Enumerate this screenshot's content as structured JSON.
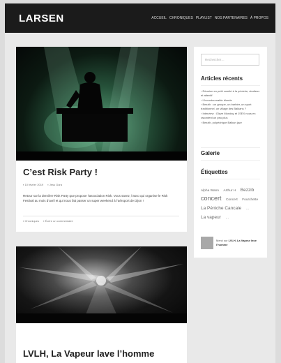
{
  "header": {
    "logo": "LARSEN",
    "nav": [
      "ACCUEIL",
      "CHRONIQUES",
      "PLAYLIST",
      "NOS PARTENAIRES",
      "À PROPOS"
    ]
  },
  "posts": [
    {
      "title": "C’est Risk Party !",
      "date": "10 février 2019",
      "author": "Jess Gora",
      "excerpt": "Retour sur la dernière Risk Party que propose l’association Risk. Vous savez, l’asso qui organise le Risk Festival au mois d’avril et qui nous fait passer un super weekend à l’aéroport de Dijon !",
      "category": "Chroniques",
      "comment_link": "Écrire un commentaire"
    },
    {
      "title": "LVLH, La Vapeur lave l’homme"
    }
  ],
  "sidebar": {
    "search_placeholder": "Rechercher…",
    "recent_title": "Articles récents",
    "recent_items": [
      "Réunion en petit comité à la péniche, studieux et attentif",
      "L’incontournable blonde",
      "Bezzib : un groupe, un barbier, un sport traditionnel, un village des Balkans ?",
      "Interview : Glaze Monday et JSEX nous en racontent un peu plus",
      "Bezzib, polyédrique Balkan jazz"
    ],
    "gallery_title": "Galerie",
    "tags_title": "Étiquettes",
    "tags": [
      {
        "label": "Alpha Wann",
        "size": "s"
      },
      {
        "label": "Arthur H",
        "size": "s"
      },
      {
        "label": "Bezzib",
        "size": "m"
      },
      {
        "label": "concert",
        "size": "l"
      },
      {
        "label": "Concert",
        "size": "s"
      },
      {
        "label": "Fourchette",
        "size": "s"
      },
      {
        "label": "La Péniche Cancale",
        "size": "m"
      },
      {
        "label": "…",
        "size": "s"
      },
      {
        "label": "La vapeur",
        "size": "m"
      },
      {
        "label": "…",
        "size": "s"
      }
    ],
    "recent_comment": {
      "prefix": "Merci sur",
      "author": "LVLH, La Vapeur lave l’homme"
    }
  }
}
